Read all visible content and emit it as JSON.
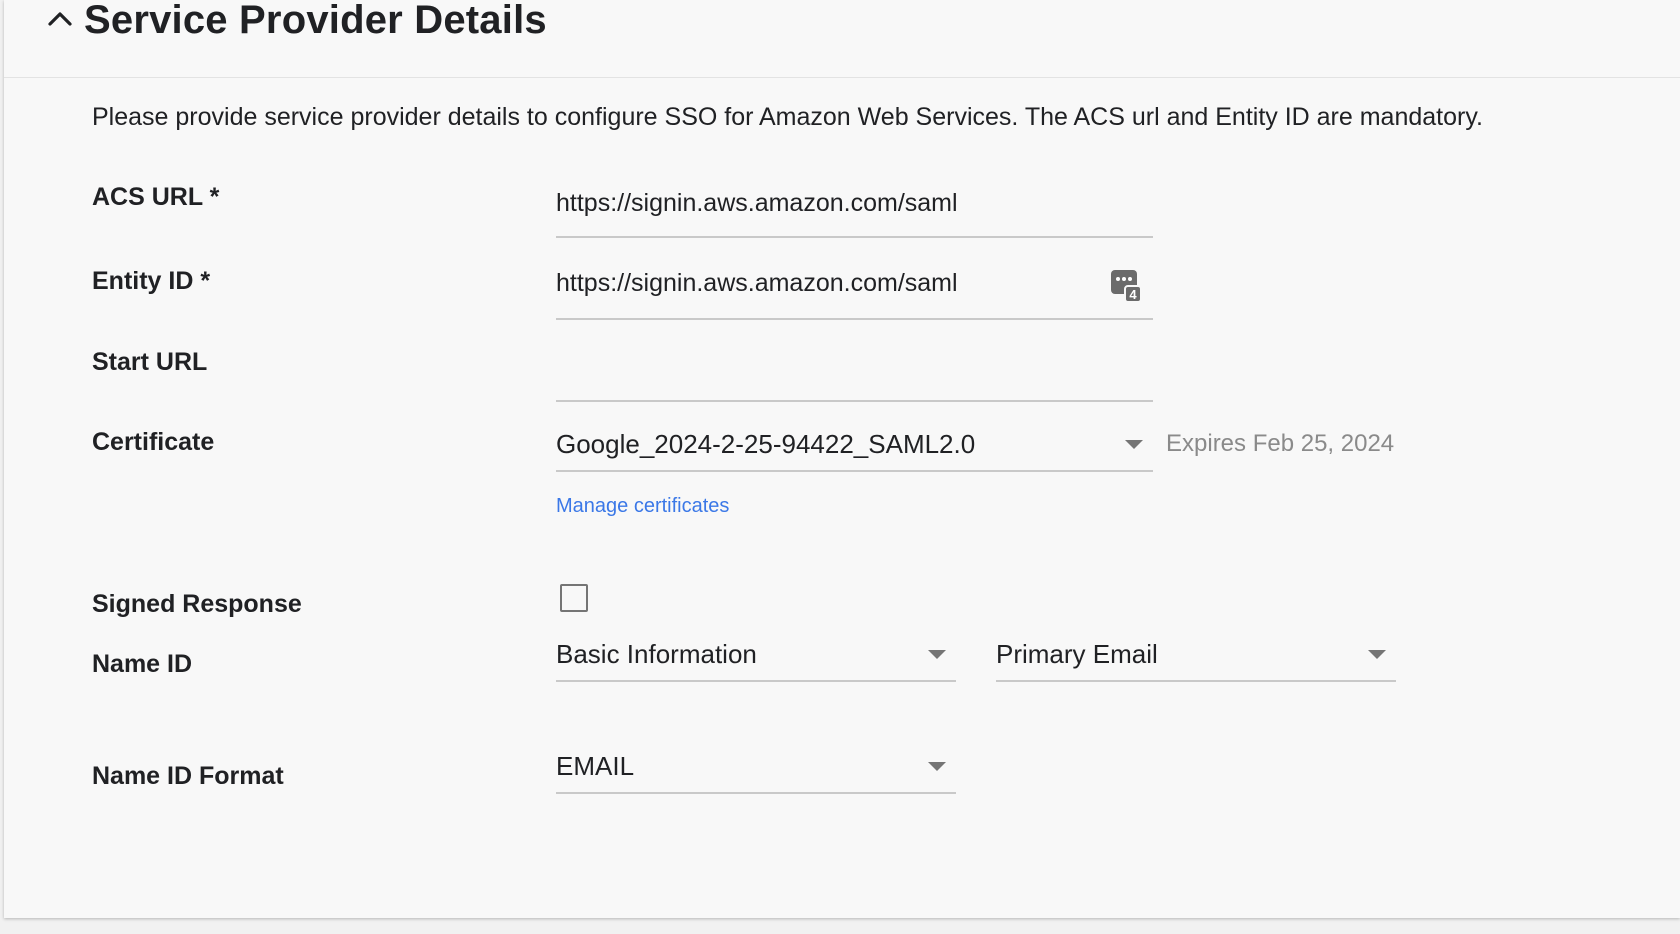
{
  "section": {
    "title": "Service Provider Details",
    "collapse_icon": "chevron-up-icon",
    "description": "Please provide service provider details to configure SSO for Amazon Web Services. The ACS url and Entity ID are mandatory."
  },
  "acs_url": {
    "label": "ACS URL *",
    "value": "https://signin.aws.amazon.com/saml"
  },
  "entity_id": {
    "label": "Entity ID *",
    "value": "https://signin.aws.amazon.com/saml",
    "password_manager_icon": "password-manager-icon",
    "password_manager_badge": "4"
  },
  "start_url": {
    "label": "Start URL",
    "value": ""
  },
  "certificate": {
    "label": "Certificate",
    "selected": "Google_2024-2-25-94422_SAML2.0",
    "expires": "Expires Feb 25, 2024",
    "manage_link": "Manage certificates"
  },
  "signed_response": {
    "label": "Signed Response",
    "checked": false
  },
  "name_id": {
    "label": "Name ID",
    "category_selected": "Basic Information",
    "field_selected": "Primary Email"
  },
  "name_id_format": {
    "label": "Name ID Format",
    "selected": "EMAIL"
  },
  "colors": {
    "link": "#3b78e7",
    "panel_bg": "#f8f8f8",
    "underline": "#c9c9c9"
  }
}
